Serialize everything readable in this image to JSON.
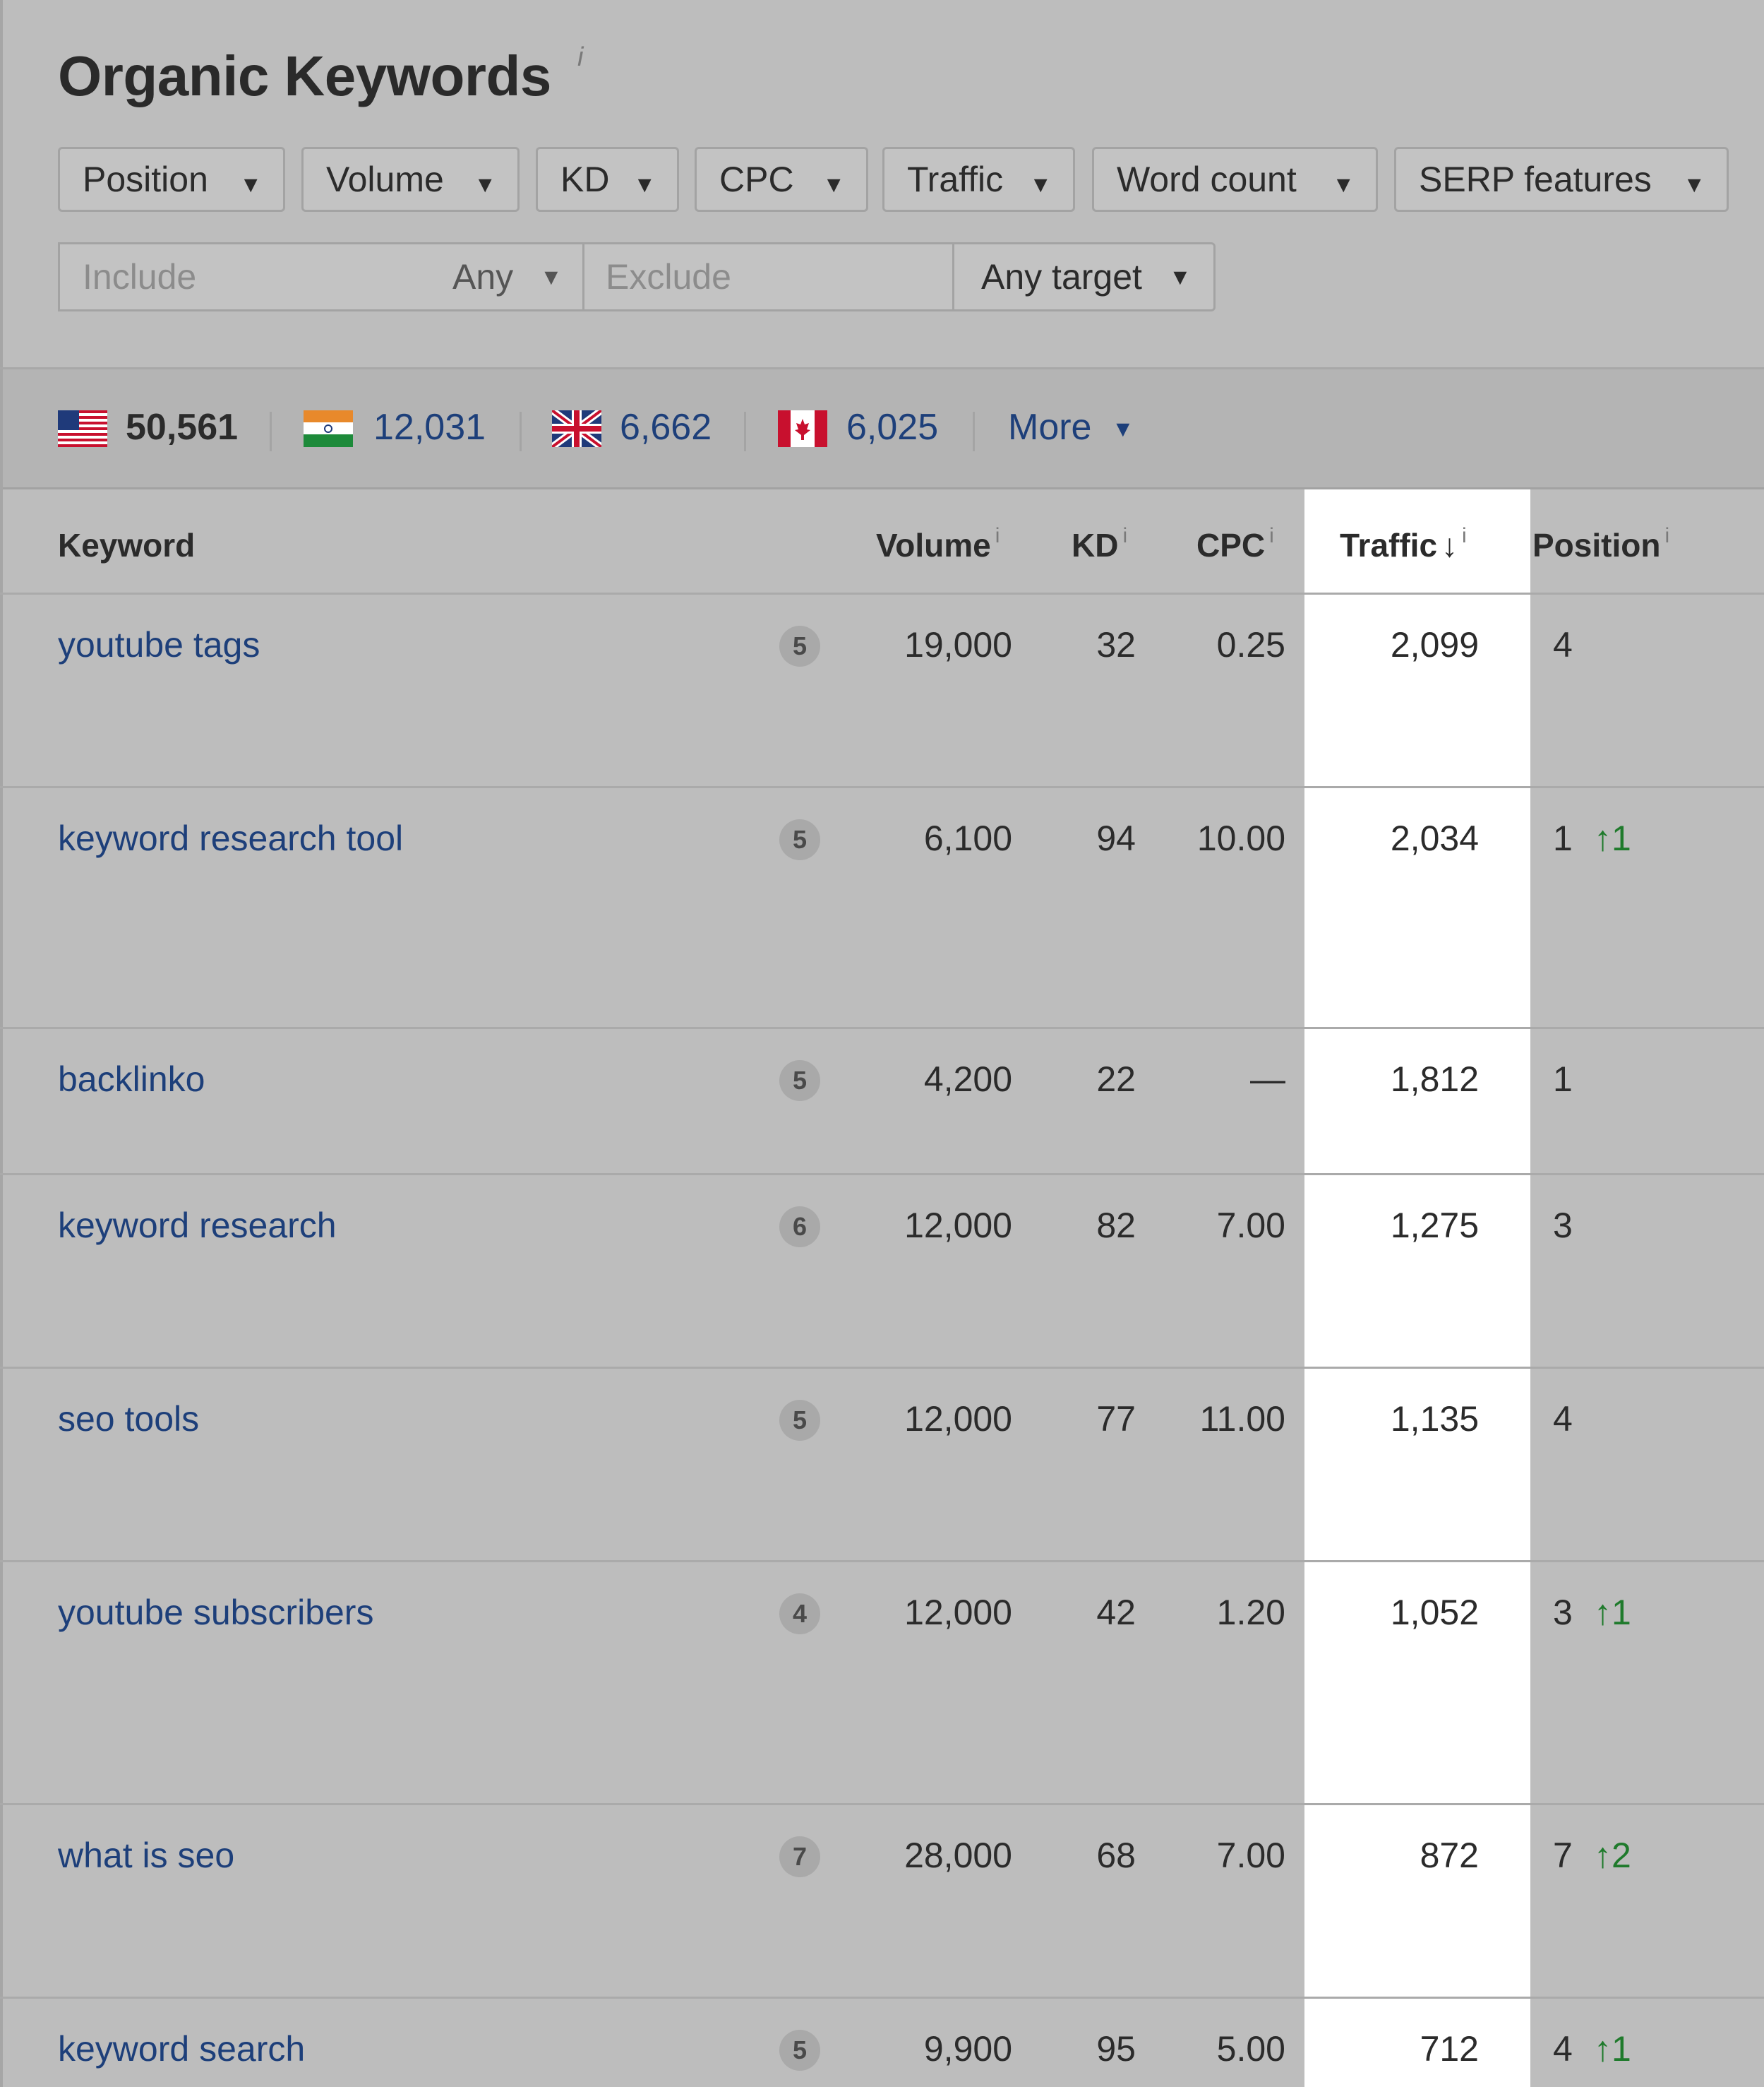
{
  "header": {
    "title": "Organic Keywords",
    "title_info": "i"
  },
  "filters": {
    "position": "Position",
    "volume": "Volume",
    "kd": "KD",
    "cpc": "CPC",
    "traffic": "Traffic",
    "word_count": "Word count",
    "serp_features": "SERP features",
    "caret": "▼"
  },
  "search": {
    "include_placeholder": "Include",
    "include_mode": "Any",
    "exclude_placeholder": "Exclude",
    "target": "Any target"
  },
  "countries": [
    {
      "flag": "us-flag-icon",
      "count": "50,561"
    },
    {
      "flag": "in-flag-icon",
      "count": "12,031"
    },
    {
      "flag": "gb-flag-icon",
      "count": "6,662"
    },
    {
      "flag": "ca-flag-icon",
      "count": "6,025"
    }
  ],
  "more_label": "More",
  "table": {
    "columns": {
      "keyword": "Keyword",
      "volume": "Volume",
      "kd": "KD",
      "cpc": "CPC",
      "traffic": "Traffic",
      "traffic_sort": "↓",
      "position": "Position",
      "info": "i"
    },
    "rows": [
      {
        "keyword": "youtube tags",
        "serp": "5",
        "volume": "19,000",
        "kd": "32",
        "cpc": "0.25",
        "traffic": "2,099",
        "position": "4",
        "change": ""
      },
      {
        "keyword": "keyword research tool",
        "serp": "5",
        "volume": "6,100",
        "kd": "94",
        "cpc": "10.00",
        "traffic": "2,034",
        "position": "1",
        "change": "↑1"
      },
      {
        "keyword": "backlinko",
        "serp": "5",
        "volume": "4,200",
        "kd": "22",
        "cpc": "—",
        "traffic": "1,812",
        "position": "1",
        "change": ""
      },
      {
        "keyword": "keyword research",
        "serp": "6",
        "volume": "12,000",
        "kd": "82",
        "cpc": "7.00",
        "traffic": "1,275",
        "position": "3",
        "change": ""
      },
      {
        "keyword": "seo tools",
        "serp": "5",
        "volume": "12,000",
        "kd": "77",
        "cpc": "11.00",
        "traffic": "1,135",
        "position": "4",
        "change": ""
      },
      {
        "keyword": "youtube subscribers",
        "serp": "4",
        "volume": "12,000",
        "kd": "42",
        "cpc": "1.20",
        "traffic": "1,052",
        "position": "3",
        "change": "↑1"
      },
      {
        "keyword": "what is seo",
        "serp": "7",
        "volume": "28,000",
        "kd": "68",
        "cpc": "7.00",
        "traffic": "872",
        "position": "7",
        "change": "↑2"
      },
      {
        "keyword": "keyword search",
        "serp": "5",
        "volume": "9,900",
        "kd": "95",
        "cpc": "5.00",
        "traffic": "712",
        "position": "4",
        "change": "↑1"
      }
    ]
  },
  "colors": {
    "link": "#1d3f7a",
    "change_up": "#1f7a2c",
    "background": "#bdbdbd",
    "highlight_column": "#ffffff"
  }
}
